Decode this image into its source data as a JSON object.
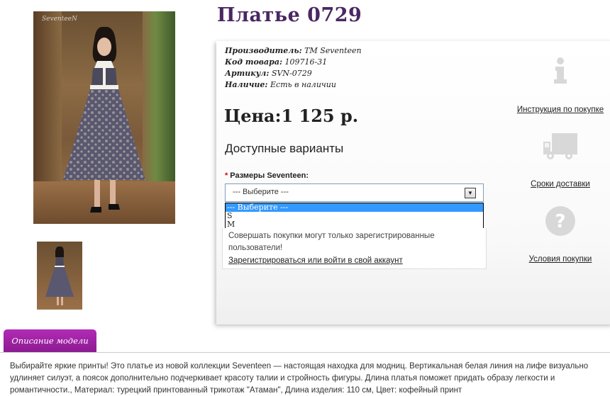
{
  "product": {
    "title": "Платье 0729",
    "watermark": "SeventeeN"
  },
  "meta": {
    "manufacturer_label": "Производитель:",
    "manufacturer_value": "ТМ Seventeen",
    "code_label": "Код товара:",
    "code_value": "109716-31",
    "sku_label": "Артикул:",
    "sku_value": "SVN-0729",
    "stock_label": "Наличие:",
    "stock_value": "Есть в наличии"
  },
  "price": {
    "text": "Цена:1 125 р."
  },
  "options": {
    "heading": "Доступные варианты",
    "size_label": "Размеры Seventeen:",
    "required_mark": "*",
    "selected": "--- Выберите ---",
    "list": [
      "--- Выберите ---",
      "S",
      "M"
    ]
  },
  "login": {
    "message": "Совершать покупки могут только зарегистрированные пользователи!",
    "link": "Зарегистрироваться или войти в свой аккаунт"
  },
  "sidebar": {
    "instructions": "Инструкция по покупке",
    "delivery": "Сроки доставки",
    "terms": "Условия покупки"
  },
  "description": {
    "tab": "Описание модели",
    "text": "Выбирайте яркие принты! Это платье из новой коллекции Seventeen — настоящая находка для модниц. Вертикальная белая линия на лифе визуально удлиняет силуэт, а поясок дополнительно подчеркивает красоту талии и стройность фигуры. Длина платья поможет придать образу легкости и романтичности., Материал: турецкий принтованный трикотаж \"Атаман\", Длина изделия: 110 см, Цвет: кофейный принт"
  },
  "colors": {
    "title": "#4a2763",
    "tab": "#a524a9",
    "select_highlight": "#3399ff"
  }
}
